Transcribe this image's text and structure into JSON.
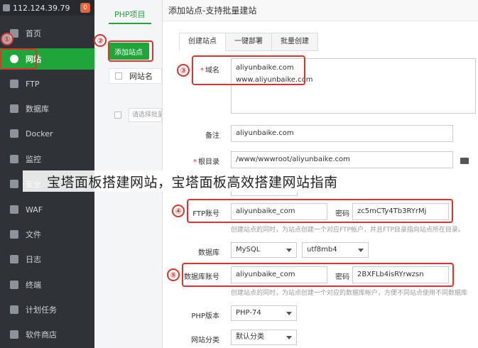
{
  "sidebar": {
    "ip": "112.124.39.79",
    "badge": "0",
    "items": [
      {
        "label": "首页",
        "icon": "home-icon"
      },
      {
        "label": "网站",
        "icon": "globe-icon"
      },
      {
        "label": "FTP",
        "icon": "ftp-icon"
      },
      {
        "label": "数据库",
        "icon": "database-icon"
      },
      {
        "label": "Docker",
        "icon": "docker-icon"
      },
      {
        "label": "监控",
        "icon": "monitor-icon"
      },
      {
        "label": "安全",
        "icon": "shield-icon"
      },
      {
        "label": "WAF",
        "icon": "waf-icon"
      },
      {
        "label": "文件",
        "icon": "folder-icon"
      },
      {
        "label": "日志",
        "icon": "log-icon"
      },
      {
        "label": "终端",
        "icon": "terminal-icon"
      },
      {
        "label": "计划任务",
        "icon": "clock-icon"
      },
      {
        "label": "软件商店",
        "icon": "store-icon"
      }
    ]
  },
  "middle": {
    "tab": "PHP项目",
    "add_button": "添加站点",
    "col_name": "网站名",
    "select_placeholder": "请选择批量操作"
  },
  "dialog": {
    "title": "添加站点-支持批量建站",
    "tabs": [
      "创建站点",
      "一键部署",
      "批量创建"
    ],
    "domain_label": "域名",
    "domain_lines": [
      "aliyunbaike.com",
      "www.aliyunbaike.com"
    ],
    "remark_label": "备注",
    "remark_value": "aliyunbaike.com",
    "root_label": "根目录",
    "root_value": "/www/wwwroot/aliyunbaike.com",
    "ftp_label_partial": "FT",
    "ftp_account_label": "FTP账号",
    "ftp_account_value": "aliyunbaike_com",
    "ftp_password_label": "密码",
    "ftp_password_value": "zc5mCTy4Tb3RYrMj",
    "ftp_hint": "创建站点的同时，为站点创建一个对应FTP帐户，并且FTP目录指向站点所在目录。",
    "db_label": "数据库",
    "db_type": "MySQL",
    "db_charset": "utf8mb4",
    "db_account_label": "数据库账号",
    "db_account_value": "aliyunbaike_com",
    "db_password_label": "密码",
    "db_password_value": "2BXFLb4isRYrwzsn",
    "db_hint": "创建站点的同时，为站点创建一个对应的数据库帐户，方便不同站点使用不同数据库",
    "php_label": "PHP版本",
    "php_value": "PHP-74",
    "category_label": "网站分类",
    "category_value": "默认分类"
  },
  "annotations": [
    "①",
    "②",
    "③",
    "④",
    "⑤"
  ],
  "caption": "宝塔面板搭建网站，宝塔面板高效搭建网站指南",
  "colors": {
    "accent": "#20a53a",
    "annotation": "#e3322b",
    "sidebar_bg": "#2f3237"
  }
}
